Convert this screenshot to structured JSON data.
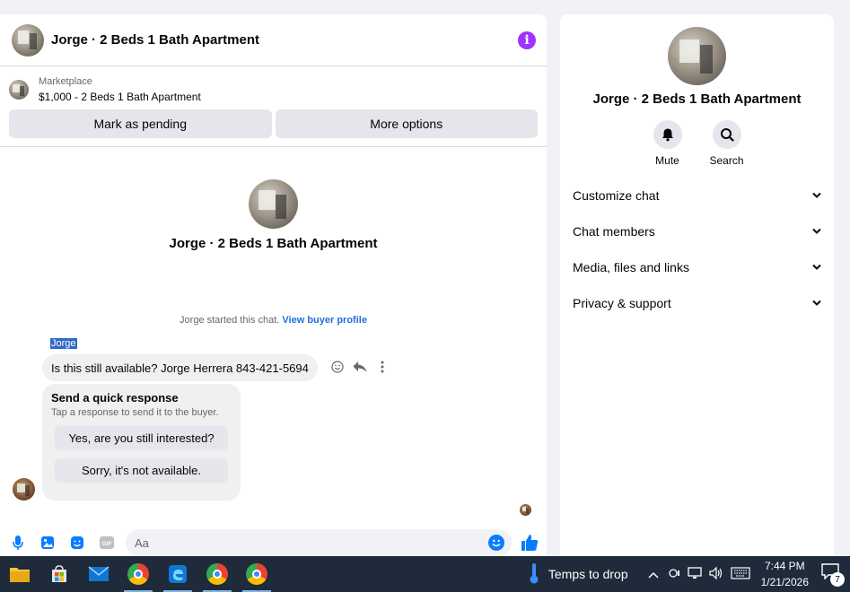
{
  "chat": {
    "title": "Jorge · 2 Beds 1 Bath Apartment",
    "listing": {
      "source": "Marketplace",
      "summary": "$1,000 - 2 Beds 1 Bath Apartment"
    },
    "buttons": {
      "mark_pending": "Mark as pending",
      "more_options": "More options"
    },
    "profile_name": "Jorge · 2 Beds 1 Bath Apartment",
    "started_text": "Jorge started this chat.",
    "view_buyer_profile": "View buyer profile",
    "sender": "Jorge",
    "message": "Is this still available? Jorge Herrera 843-421-5694",
    "quick_response": {
      "title": "Send a quick response",
      "subtitle": "Tap a response to send it to the buyer.",
      "options": [
        "Yes, are you still interested?",
        "Sorry, it's not available."
      ]
    },
    "composer": {
      "placeholder": "Aa",
      "gif_label": "GIF"
    }
  },
  "side_panel": {
    "name": "Jorge · 2 Beds 1 Bath Apartment",
    "actions": [
      {
        "label": "Mute",
        "icon": "bell-icon"
      },
      {
        "label": "Search",
        "icon": "search-icon"
      }
    ],
    "menu": [
      "Customize chat",
      "Chat members",
      "Media, files and links",
      "Privacy & support"
    ]
  },
  "taskbar": {
    "weather": "Temps to drop",
    "time": "7:44 PM",
    "date": "1/21/2026",
    "notifications": "7"
  },
  "colors": {
    "accent": "#0a7cff",
    "link": "#216fdb",
    "info": "#a033ff",
    "taskbar": "#1f2a3a"
  }
}
